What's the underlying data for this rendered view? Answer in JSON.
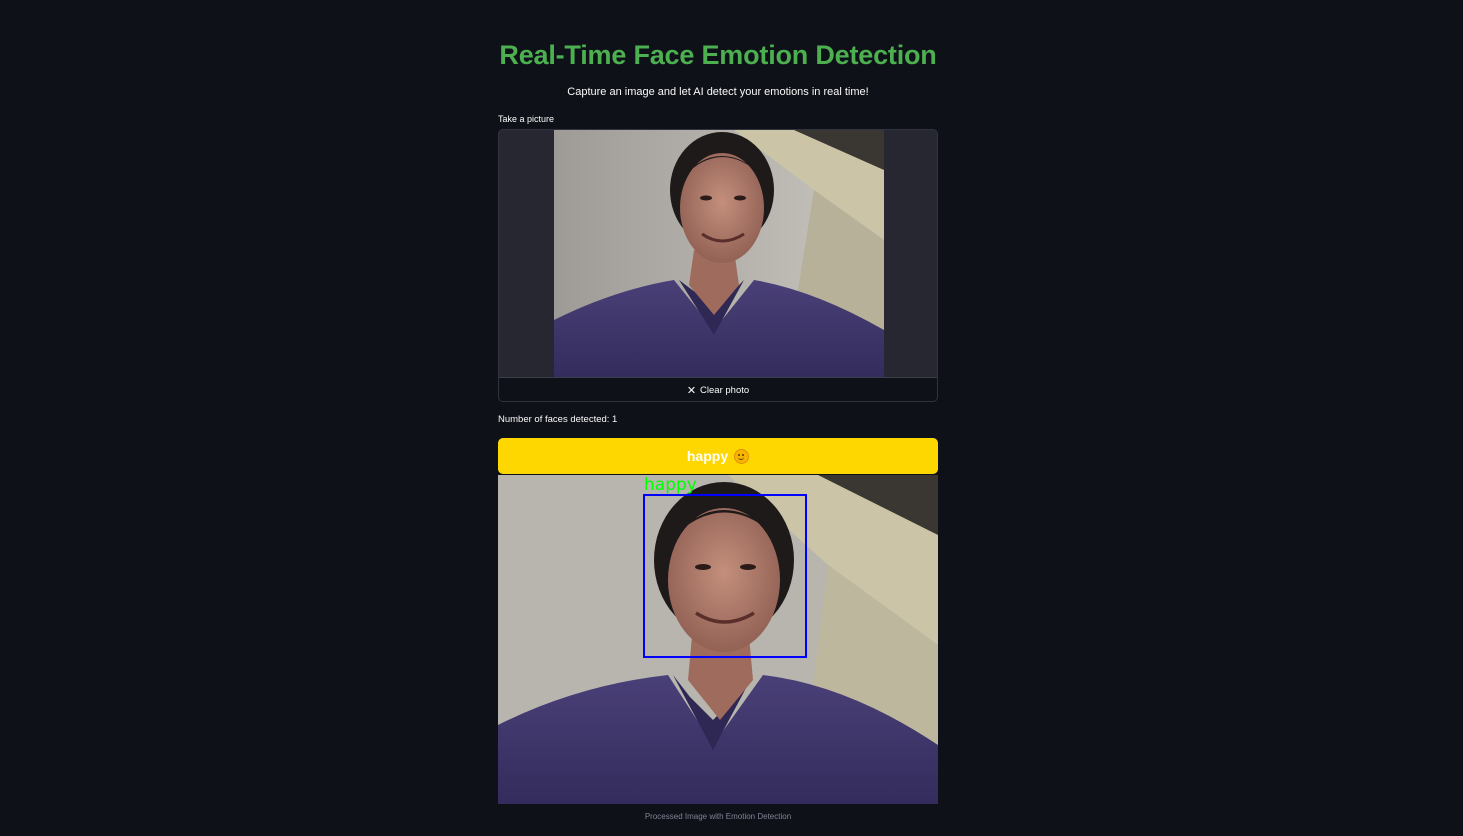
{
  "header": {
    "title": "Real-Time Face Emotion Detection",
    "subtitle": "Capture an image and let AI detect your emotions in real time!"
  },
  "camera": {
    "label": "Take a picture",
    "clear_button_label": "Clear photo",
    "clear_icon": "close-icon"
  },
  "results": {
    "faces_detected_text": "Number of faces detected: 1",
    "emotion_label": "happy",
    "emotion_icon": "smiling-face-icon",
    "box_label": "happy",
    "caption": "Processed Image with Emotion Detection"
  },
  "colors": {
    "title": "#4caf50",
    "banner": "#ffd700",
    "face_box": "#0000ff",
    "box_label": "#00ff00",
    "background": "#0e1117"
  }
}
